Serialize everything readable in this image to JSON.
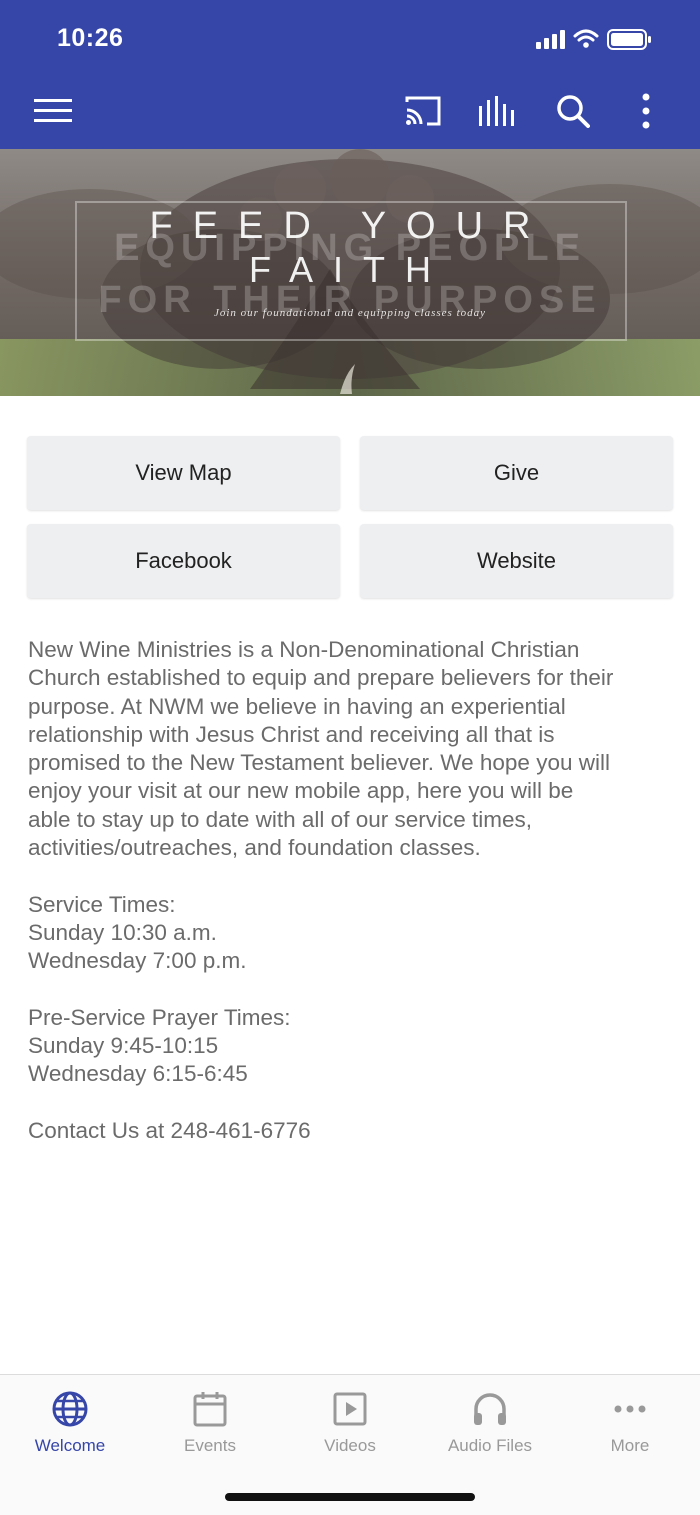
{
  "status_bar": {
    "time": "10:26"
  },
  "app_bar": {
    "icons": [
      "menu-icon",
      "cast-icon",
      "audio-bars-icon",
      "search-icon",
      "more-vertical-icon"
    ]
  },
  "banner": {
    "line1": "FEED YOUR",
    "line2": "FAITH",
    "ghost1": "EQUIPPING PEOPLE",
    "ghost2": "FOR THEIR PURPOSE",
    "subtitle": "Join our foundational and equipping classes today"
  },
  "buttons": {
    "view_map": "View Map",
    "give": "Give",
    "facebook": "Facebook",
    "website": "Website"
  },
  "content": {
    "intro": "New Wine Ministries is a Non-Denominational Christian\nChurch established to equip and prepare believers for their\npurpose. At NWM we believe in having an experiential\nrelationship with Jesus Christ and receiving all that is\npromised to the New Testament believer.  We hope you will\nenjoy your visit at our new mobile app, here you will be\nable to stay up to date with all of our service times,\nactivities/outreaches, and foundation classes.",
    "service_times": "Service Times:\nSunday 10:30 a.m.\nWednesday 7:00 p.m.",
    "prayer_times": "Pre-Service Prayer Times:\nSunday 9:45-10:15\nWednesday 6:15-6:45",
    "contact": "Contact Us at 248-461-6776"
  },
  "bottom_nav": {
    "items": [
      {
        "label": "Welcome",
        "icon": "globe-icon",
        "active": true
      },
      {
        "label": "Events",
        "icon": "calendar-icon",
        "active": false
      },
      {
        "label": "Videos",
        "icon": "video-play-icon",
        "active": false
      },
      {
        "label": "Audio Files",
        "icon": "headphones-icon",
        "active": false
      },
      {
        "label": "More",
        "icon": "more-horizontal-icon",
        "active": false
      }
    ]
  },
  "colors": {
    "primary": "#3646a8",
    "button_bg": "#eeeff1",
    "text_gray": "#6b6b6b",
    "nav_inactive": "#999999"
  }
}
